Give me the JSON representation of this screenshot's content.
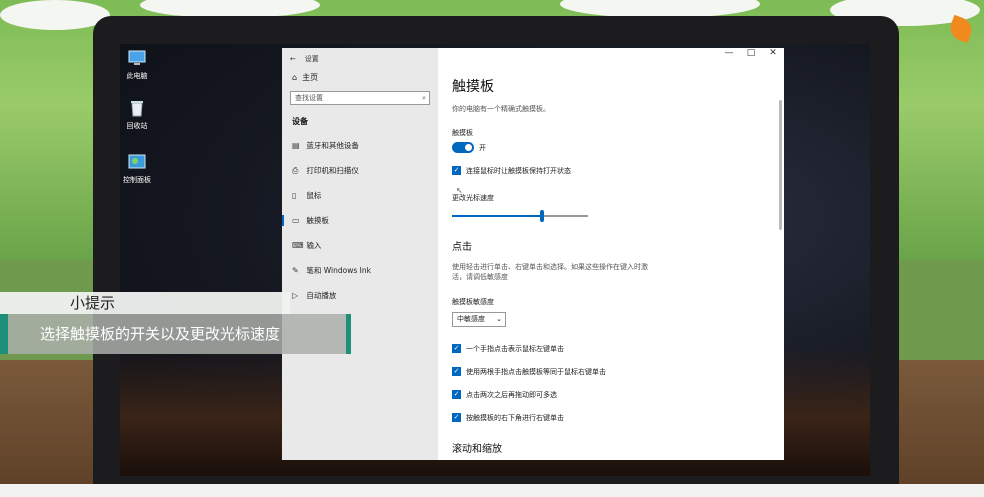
{
  "desktop": {
    "icons": [
      {
        "label": "此电脑",
        "icon": "computer-icon"
      },
      {
        "label": "回收站",
        "icon": "recycle-bin-icon"
      },
      {
        "label": "控制面板",
        "icon": "control-panel-icon"
      }
    ]
  },
  "settings": {
    "window_title": "设置",
    "home_label": "主页",
    "search_placeholder": "查找设置",
    "section_label": "设备",
    "nav": [
      {
        "label": "蓝牙和其他设备",
        "icon": "bluetooth-device-icon"
      },
      {
        "label": "打印机和扫描仪",
        "icon": "printer-icon"
      },
      {
        "label": "鼠标",
        "icon": "mouse-icon"
      },
      {
        "label": "触摸板",
        "icon": "touchpad-icon",
        "active": true
      },
      {
        "label": "输入",
        "icon": "keyboard-icon"
      },
      {
        "label": "笔和 Windows Ink",
        "icon": "pen-icon"
      },
      {
        "label": "自动播放",
        "icon": "autoplay-icon"
      }
    ],
    "window_controls": {
      "minimize": "—",
      "maximize": "□",
      "close": "✕"
    },
    "page_title": "触摸板",
    "page_subtitle": "你的电脑有一个精确式触摸板。",
    "toggle_label": "触摸板",
    "toggle_state": "开",
    "toggle_on": true,
    "keep_on_label": "连接鼠标时让触摸板保持打开状态",
    "keep_on_checked": true,
    "speed_label": "更改光标速度",
    "speed_value": 0.66,
    "tap_heading": "点击",
    "tap_desc_1": "使用轻击进行单击、右键单击和选择。如果这些操作在键入时激",
    "tap_desc_2": "活，请调低敏感度",
    "sensitivity_label": "触摸板敏感度",
    "sensitivity_value": "中敏感度",
    "checkboxes": [
      "一个手指点击表示鼠标左键单击",
      "使用两根手指点击触摸板等同于鼠标右键单击",
      "点击两次之后再拖动即可多选",
      "按触摸板的右下角进行右键单击"
    ],
    "scroll_heading": "滚动和缩放"
  },
  "tip": {
    "title": "小提示",
    "text": "选择触摸板的开关以及更改光标速度"
  },
  "colors": {
    "accent": "#0067c0",
    "tip_accent": "#1e8f78"
  }
}
